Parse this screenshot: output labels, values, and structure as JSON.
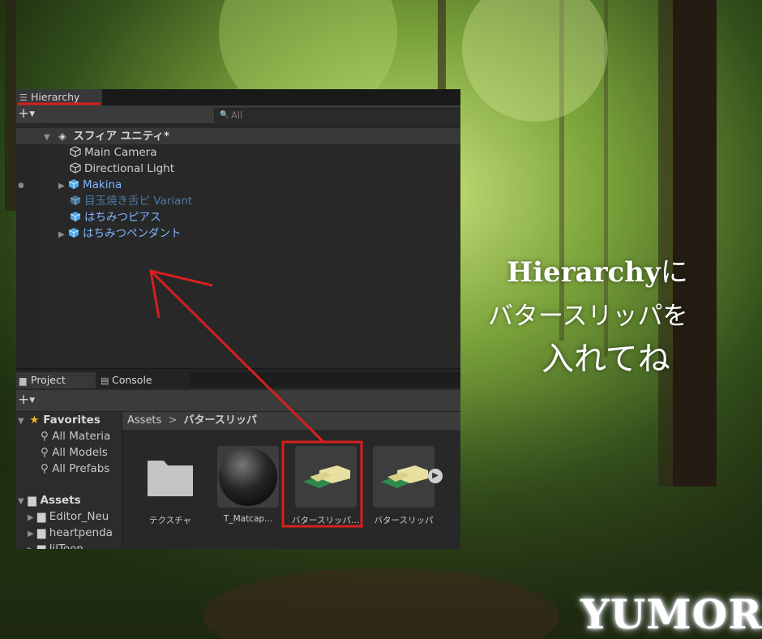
{
  "background": {
    "description_colors": [
      "#2f4a1a",
      "#7da63a",
      "#c7e07a"
    ]
  },
  "hierarchy": {
    "tab_label": "Hierarchy",
    "search_placeholder": "All",
    "scene_name": "スフィア ユニティ*",
    "items": [
      {
        "label": "Main Camera",
        "style": "white",
        "icon": "cube-outline-icon"
      },
      {
        "label": "Directional Light",
        "style": "white",
        "icon": "cube-outline-icon"
      },
      {
        "label": "Makina",
        "style": "blue",
        "icon": "prefab-cube-icon"
      },
      {
        "label": "目玉焼き舌ピ Variant",
        "style": "dim",
        "icon": "prefab-variant-icon"
      },
      {
        "label": "はちみつピアス",
        "style": "blue",
        "icon": "prefab-cube-icon"
      },
      {
        "label": "はちみつペンダント",
        "style": "blue",
        "icon": "prefab-cube-icon"
      }
    ]
  },
  "project": {
    "tabs": [
      "Project",
      "Console"
    ],
    "favorites_label": "Favorites",
    "favorites": [
      "All Materia",
      "All Models",
      "All Prefabs"
    ],
    "assets_label": "Assets",
    "folders": [
      "Editor_Neu",
      "heartpenda",
      "lilToon"
    ],
    "breadcrumb": {
      "root": "Assets",
      "separator": ">",
      "current": "バタースリッパ"
    },
    "assets": [
      {
        "label": "テクスチャ",
        "type": "folder"
      },
      {
        "label": "T_Matcap...",
        "type": "material"
      },
      {
        "label": "バタースリッパ ...",
        "type": "model"
      },
      {
        "label": "バタースリッパ",
        "type": "prefab"
      }
    ]
  },
  "annotation": {
    "line1_a": "Hierarchy",
    "line1_b": "に",
    "line2": "バタースリッパを",
    "line3": "入れてね",
    "highlight_color": "#d71f1f"
  },
  "watermark": "YUMOR"
}
